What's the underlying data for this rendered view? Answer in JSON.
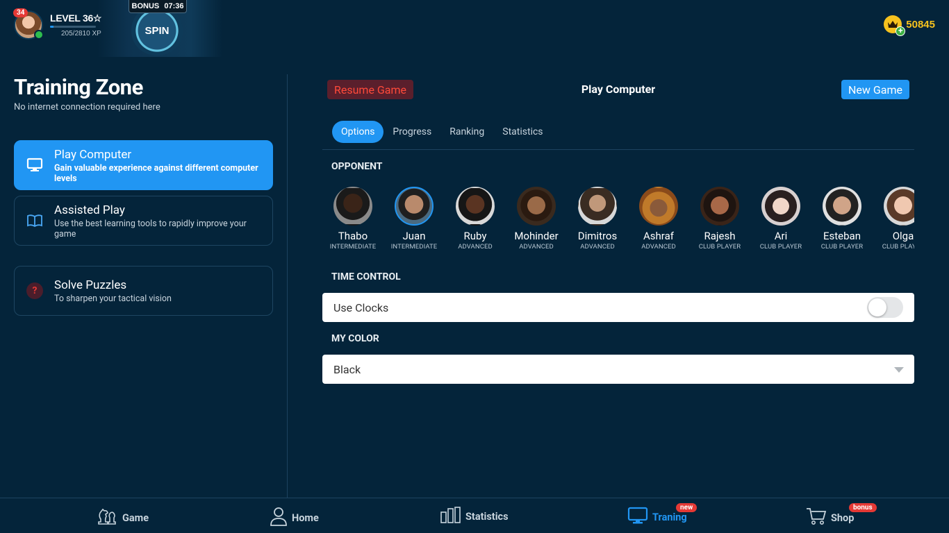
{
  "header": {
    "notifications": "34",
    "level": "LEVEL 36☆",
    "xp": "205/2810 XP",
    "xp_progress": 0.073,
    "bonus_label": "BONUS",
    "bonus_timer": "07:36",
    "spin_label": "SPIN",
    "coins": "50845"
  },
  "sidebar": {
    "title": "Training Zone",
    "subtitle": "No internet connection required here",
    "items": [
      {
        "title": "Play Computer",
        "desc": "Gain valuable experience against different computer levels",
        "icon": "monitor-icon"
      },
      {
        "title": "Assisted Play",
        "desc": "Use the best learning tools to rapidly improve your game",
        "icon": "book-icon"
      },
      {
        "title": "Solve Puzzles",
        "desc": "To sharpen your tactical vision",
        "icon": "question-icon"
      }
    ]
  },
  "main": {
    "resume_label": "Resume Game",
    "title": "Play Computer",
    "new_game_label": "New Game",
    "tabs": [
      "Options",
      "Progress",
      "Ranking",
      "Statistics"
    ],
    "opponent_heading": "OPPONENT",
    "opponents": [
      {
        "name": "Thabo",
        "level": "INTERMEDIATE"
      },
      {
        "name": "Juan",
        "level": "INTERMEDIATE"
      },
      {
        "name": "Ruby",
        "level": "ADVANCED"
      },
      {
        "name": "Mohinder",
        "level": "ADVANCED"
      },
      {
        "name": "Dimitros",
        "level": "ADVANCED"
      },
      {
        "name": "Ashraf",
        "level": "ADVANCED"
      },
      {
        "name": "Rajesh",
        "level": "CLUB PLAYER"
      },
      {
        "name": "Ari",
        "level": "CLUB PLAYER"
      },
      {
        "name": "Esteban",
        "level": "CLUB PLAYER"
      },
      {
        "name": "Olga",
        "level": "CLUB PLAYER"
      }
    ],
    "time_control_heading": "TIME CONTROL",
    "use_clocks_label": "Use Clocks",
    "my_color_heading": "MY COLOR",
    "my_color_value": "Black"
  },
  "nav": {
    "items": [
      {
        "label": "Game",
        "icon": "knight-icon"
      },
      {
        "label": "Home",
        "icon": "person-icon"
      },
      {
        "label": "Statistics",
        "icon": "bars-icon"
      },
      {
        "label": "Traning",
        "icon": "monitor-icon",
        "badge": "new"
      },
      {
        "label": "Shop",
        "icon": "cart-icon",
        "badge": "bonus"
      }
    ]
  },
  "colors": {
    "accent": "#2196f3",
    "background": "#04243a",
    "danger": "#e53935",
    "gold": "#f6c21e"
  }
}
